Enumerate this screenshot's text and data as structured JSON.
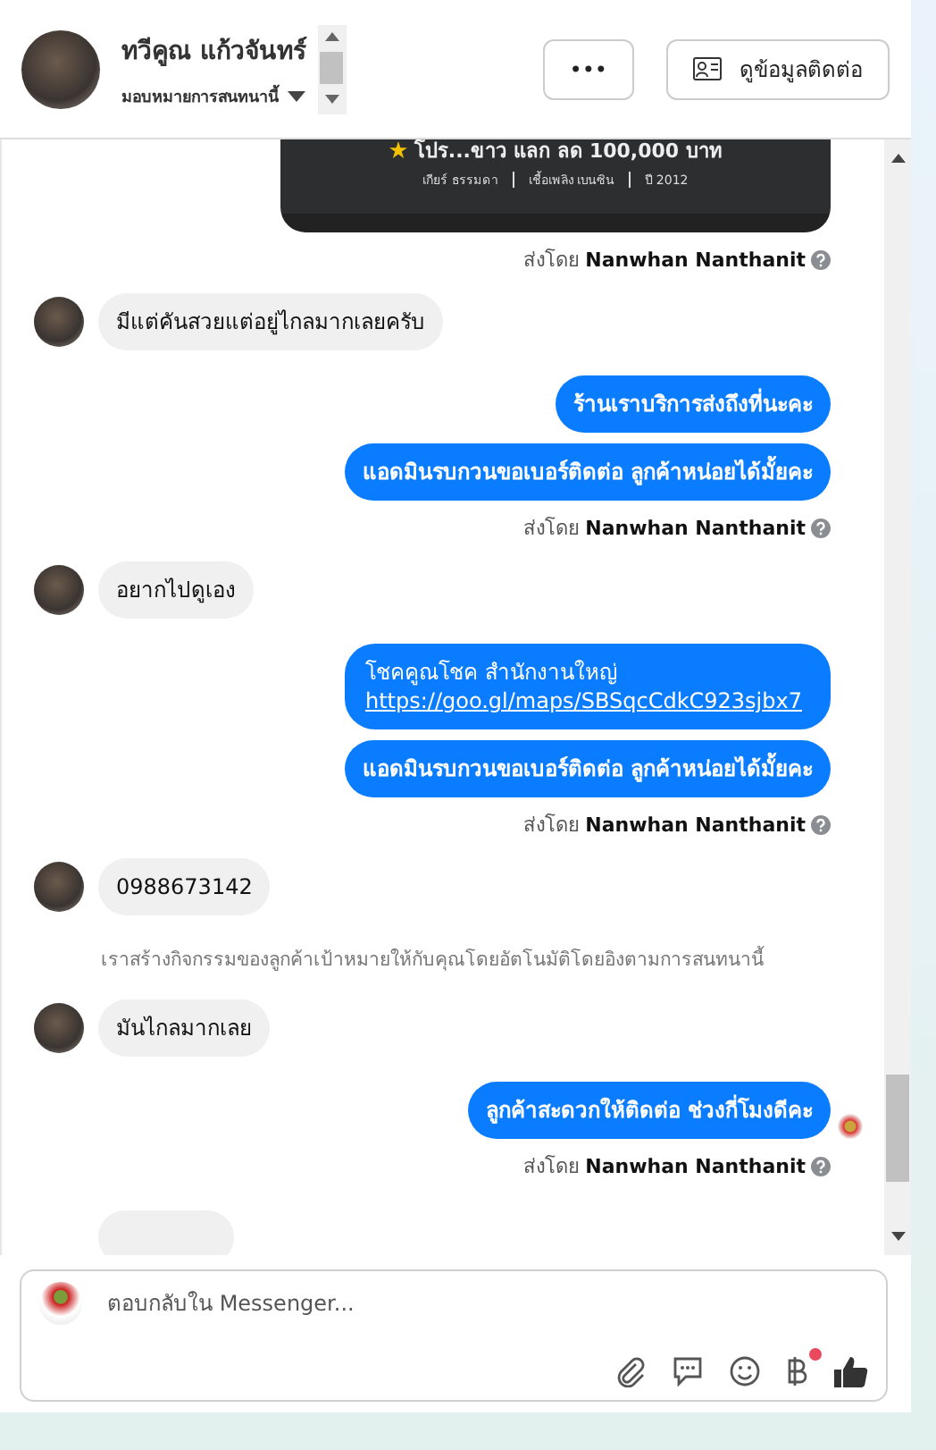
{
  "header": {
    "name": "ทวีคูณ แก้วจันทร์",
    "assign": "มอบหมายการสนทนานี้",
    "more_button": "•••",
    "contact_button": "ดูข้อมูลติดต่อ"
  },
  "messages": [
    {
      "kind": "card",
      "title": "โปร...ขาว แลก ลด 100,000 บาท",
      "specs": [
        "เกียร์ ธรรมดา",
        "เชื้อเพลิง เบนซิน",
        "ปี 2012"
      ]
    },
    {
      "kind": "sender",
      "text": "ส่งโดย **Nanwhan Nanthanit**"
    },
    {
      "kind": "in",
      "text": "มีแต่คันสวยแต่อยู่ไกลมากเลยครับ"
    },
    {
      "kind": "out",
      "text": "ร้านเราบริการส่งถึงที่นะคะ"
    },
    {
      "kind": "out",
      "text": "แอดมินรบกวนขอเบอร์ติดต่อ ลูกค้าหน่อยได้มั้ยคะ"
    },
    {
      "kind": "sender",
      "text": "ส่งโดย **Nanwhan Nanthanit**"
    },
    {
      "kind": "in",
      "text": "อยากไปดูเอง"
    },
    {
      "kind": "out",
      "text": "โชคคูณโชค สำนักงานใหญ่",
      "link": "https://goo.gl/maps/SBSqcCdkC923sjbx7"
    },
    {
      "kind": "out",
      "text": "แอดมินรบกวนขอเบอร์ติดต่อ ลูกค้าหน่อยได้มั้ยคะ"
    },
    {
      "kind": "sender",
      "text": "ส่งโดย **Nanwhan Nanthanit**"
    },
    {
      "kind": "in",
      "text": "0988673142"
    },
    {
      "kind": "notice",
      "text": "เราสร้างกิจกรรมของลูกค้าเป้าหมายให้กับคุณโดยอัตโนมัติโดยอิงตามการสนทนานี้"
    },
    {
      "kind": "in",
      "text": "มันไกลมากเลย"
    },
    {
      "kind": "out",
      "text": "ลูกค้าสะดวกให้ติดต่อ ช่วงกี่โมงดีคะ",
      "seen": true
    },
    {
      "kind": "sender",
      "text": "ส่งโดย **Nanwhan Nanthanit**"
    }
  ],
  "composer": {
    "placeholder": "ตอบกลับใน Messenger...",
    "payment_notification": true
  }
}
